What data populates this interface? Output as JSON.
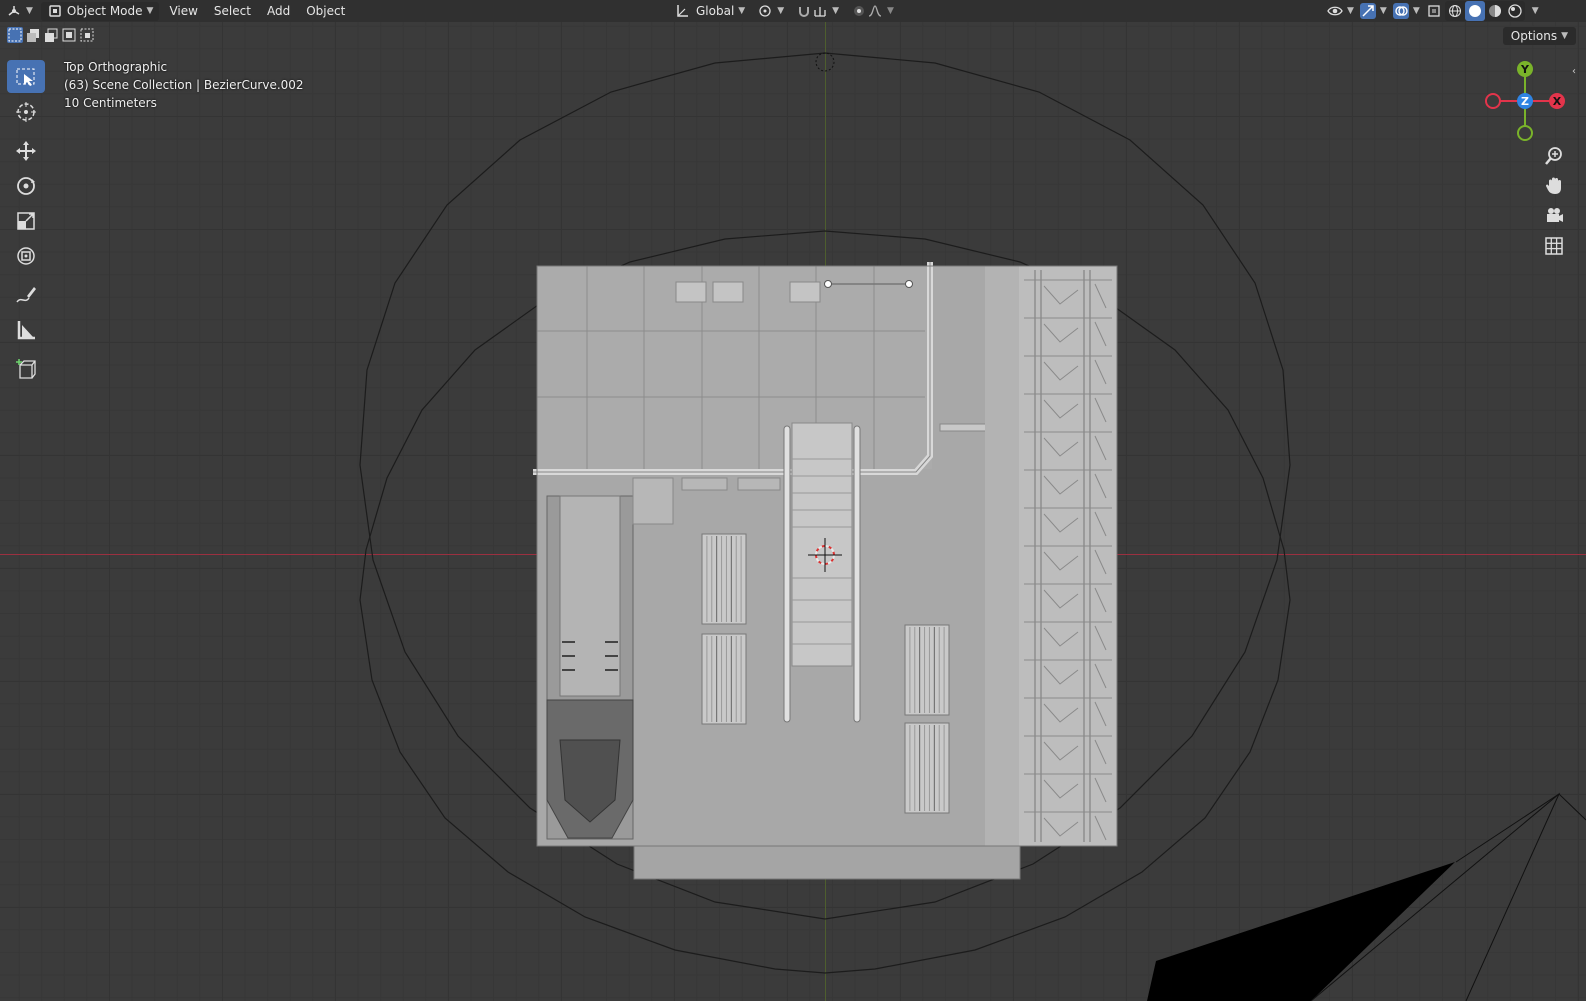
{
  "header": {
    "editor_type_icon": "3d-viewport-icon",
    "mode": "Object Mode",
    "menus": [
      "View",
      "Select",
      "Add",
      "Object"
    ],
    "orientation": "Global",
    "options_label": "Options"
  },
  "overlay": {
    "view_name": "Top Orthographic",
    "collection": "(63) Scene Collection | BezierCurve.002",
    "grid_scale": "10 Centimeters"
  },
  "gizmo": {
    "y_label": "Y",
    "z_label": "Z",
    "x_label": "X",
    "colors": {
      "x": "#e3344b",
      "y": "#7ab32a",
      "z": "#2f84e3"
    }
  },
  "toolbar": {
    "tools": [
      "select-box-icon",
      "cursor-icon",
      "move-icon",
      "rotate-icon",
      "scale-icon",
      "transform-icon",
      "annotate-icon",
      "measure-icon",
      "add-cube-icon"
    ]
  },
  "colors": {
    "accent": "#4772b3",
    "header_bg": "#303030",
    "viewport_bg": "#3b3b3b"
  }
}
